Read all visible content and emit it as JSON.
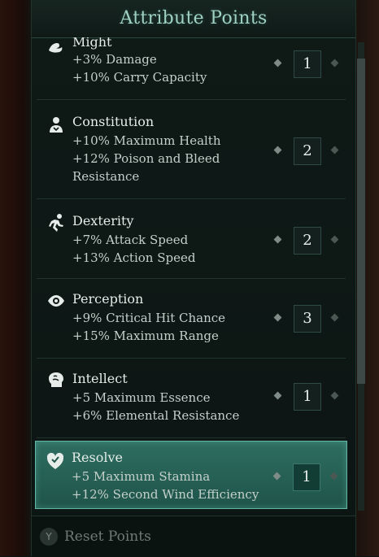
{
  "header": {
    "title": "Attribute Points"
  },
  "attributes": [
    {
      "name": "Might",
      "lines": [
        "+3% Damage",
        "+10% Carry Capacity"
      ],
      "value": "1",
      "icon": "flexed-arm-icon"
    },
    {
      "name": "Constitution",
      "lines": [
        "+10% Maximum Health",
        "+12% Poison and Bleed",
        "Resistance"
      ],
      "value": "2",
      "icon": "torso-icon"
    },
    {
      "name": "Dexterity",
      "lines": [
        "+7% Attack Speed",
        "+13% Action Speed"
      ],
      "value": "2",
      "icon": "running-figure-icon"
    },
    {
      "name": "Perception",
      "lines": [
        "+9% Critical Hit Chance",
        "+15% Maximum Range"
      ],
      "value": "3",
      "icon": "eye-icon"
    },
    {
      "name": "Intellect",
      "lines": [
        "+5 Maximum Essence",
        "+6% Elemental Resistance"
      ],
      "value": "1",
      "icon": "head-brain-icon"
    },
    {
      "name": "Resolve",
      "lines": [
        "+5 Maximum Stamina",
        "+12% Second Wind Efficiency"
      ],
      "value": "1",
      "icon": "heart-shield-icon",
      "selected": true
    }
  ],
  "footer": {
    "button_glyph": "Y",
    "reset_label": "Reset Points"
  },
  "colors": {
    "accent": "#9fd2c3",
    "selected_bg": "#2f6d61"
  }
}
